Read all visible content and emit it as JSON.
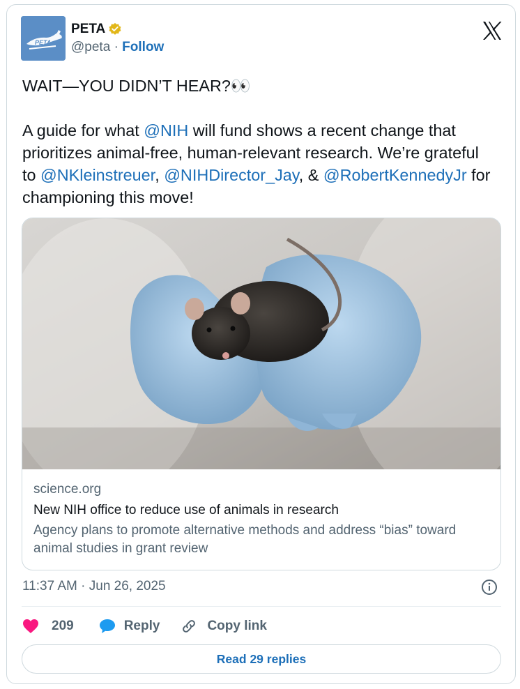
{
  "author": {
    "display_name": "PETA",
    "handle": "@peta",
    "separator": "·",
    "follow_label": "Follow",
    "avatar_text": "PETA",
    "verified": true
  },
  "tweet": {
    "line1": "WAIT—YOU DIDN’T HEAR?",
    "line1_emoji": "👀",
    "p2_before": "A guide for what ",
    "mention_nih": "@NIH",
    "p2_after": " will fund shows a recent change that prioritizes animal-free, human-relevant research. We’re grateful to ",
    "mention_kleinstreuer": "@NKleinstreuer",
    "comma": ", ",
    "mention_director": "@NIHDirector_Jay",
    "amp": ", & ",
    "mention_rfk": "@RobertKennedyJr",
    "p2_end": " for championing this move!"
  },
  "link_card": {
    "domain": "science.org",
    "title": "New NIH office to reduce use of animals in research",
    "description": "Agency plans to promote alternative methods and address “bias” toward animal studies in grant review"
  },
  "timestamp": "11:37 AM · Jun 26, 2025",
  "actions": {
    "like_count": "209",
    "reply_label": "Reply",
    "copy_label": "Copy link"
  },
  "read_replies_label": "Read 29 replies",
  "colors": {
    "link_blue": "#1d6fb8",
    "muted": "#536471",
    "heart": "#f91880",
    "verified_gold": "#e2b719",
    "avatar_blue": "#5b8ec6"
  }
}
